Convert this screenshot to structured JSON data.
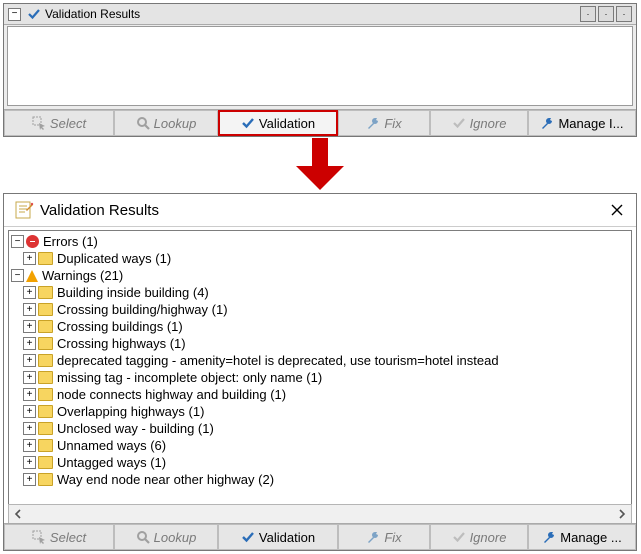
{
  "panel_small": {
    "title": "Validation Results"
  },
  "toolbar": {
    "select": "Select",
    "lookup": "Lookup",
    "validation": "Validation",
    "fix": "Fix",
    "ignore": "Ignore",
    "manage_small": "Manage I...",
    "manage_large": "Manage ..."
  },
  "panel_large": {
    "title": "Validation Results"
  },
  "tree": {
    "errors_label": "Errors (1)",
    "errors_children": [
      "Duplicated ways (1)"
    ],
    "warnings_label": "Warnings (21)",
    "warnings_children": [
      "Building inside building (4)",
      "Crossing building/highway (1)",
      "Crossing buildings (1)",
      "Crossing highways (1)",
      "deprecated tagging - amenity=hotel is deprecated, use tourism=hotel instead",
      "missing tag - incomplete object: only name (1)",
      "node connects highway and building (1)",
      "Overlapping highways (1)",
      "Unclosed way - building (1)",
      "Unnamed ways (6)",
      "Untagged ways (1)",
      "Way end node near other highway (2)"
    ]
  }
}
